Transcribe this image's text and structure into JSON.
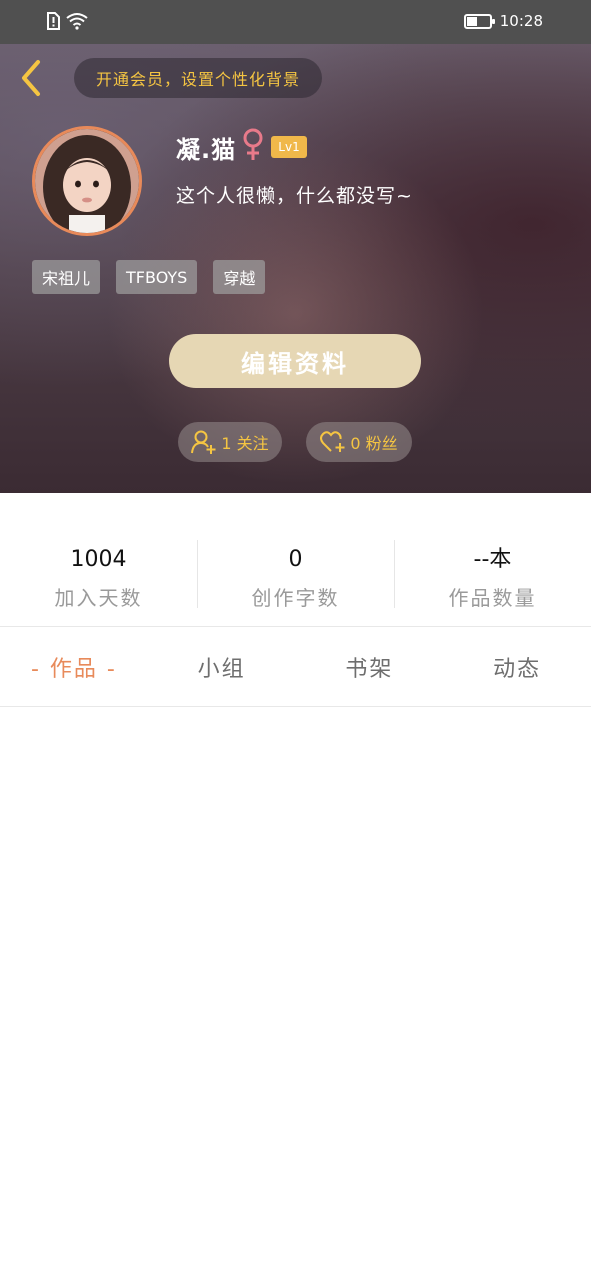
{
  "status_bar": {
    "time": "10:28",
    "icons": [
      "sim-alert-icon",
      "wifi-icon",
      "battery-icon"
    ]
  },
  "header": {
    "back_icon": "chevron-left-icon",
    "vip_text": "开通会员，设置个性化背景",
    "username": "凝.猫",
    "gender_icon": "female-icon",
    "level": "Lv1",
    "bio": "这个人很懒，什么都没写~",
    "tags": [
      "宋祖儿",
      "TFBOYS",
      "穿越"
    ],
    "edit_button": "编辑资料",
    "follow_text": "1 关注",
    "fans_text": "0 粉丝"
  },
  "stats": [
    {
      "value": "1004",
      "label": "加入天数"
    },
    {
      "value": "0",
      "label": "创作字数"
    },
    {
      "value": "--本",
      "label": "作品数量"
    }
  ],
  "tabs": [
    {
      "label": "- 作品 -",
      "active": true
    },
    {
      "label": "小组",
      "active": false
    },
    {
      "label": "书架",
      "active": false
    },
    {
      "label": "动态",
      "active": false
    }
  ],
  "colors": {
    "accent": "#e88a5a",
    "vip_text": "#f5c542",
    "edit_button": "#e6d7b4",
    "level_badge": "#f0b84a"
  }
}
